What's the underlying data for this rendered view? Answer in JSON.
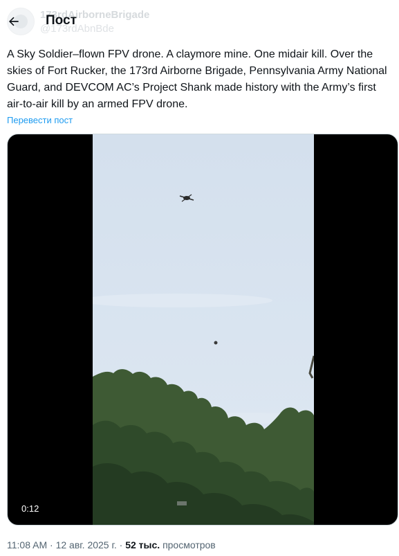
{
  "header": {
    "title": "Пост",
    "back_icon": "arrow-left-icon",
    "underlay_author_name": "173rdAirborneBrigade",
    "underlay_author_handle": "@173rdAbnBde"
  },
  "post": {
    "text": "A Sky Soldier–flown FPV drone. A claymore mine. One midair kill. Over the skies of Fort Rucker, the 173rd Airborne Brigade, Pennsylvania Army National Guard, and DEVCOM AC’s Project Shank made history with the Army’s first air-to-air kill by an armed FPV drone.",
    "translate_label": "Перевести пост"
  },
  "media": {
    "duration": "0:12"
  },
  "meta": {
    "time": "11:08 AM",
    "separator": " · ",
    "date": "12 авг. 2025 г.",
    "views_count": "52 тыс.",
    "views_label": "просмотров"
  },
  "colors": {
    "link": "#1d9bf0",
    "text": "#0f1419",
    "secondary": "#536471"
  }
}
